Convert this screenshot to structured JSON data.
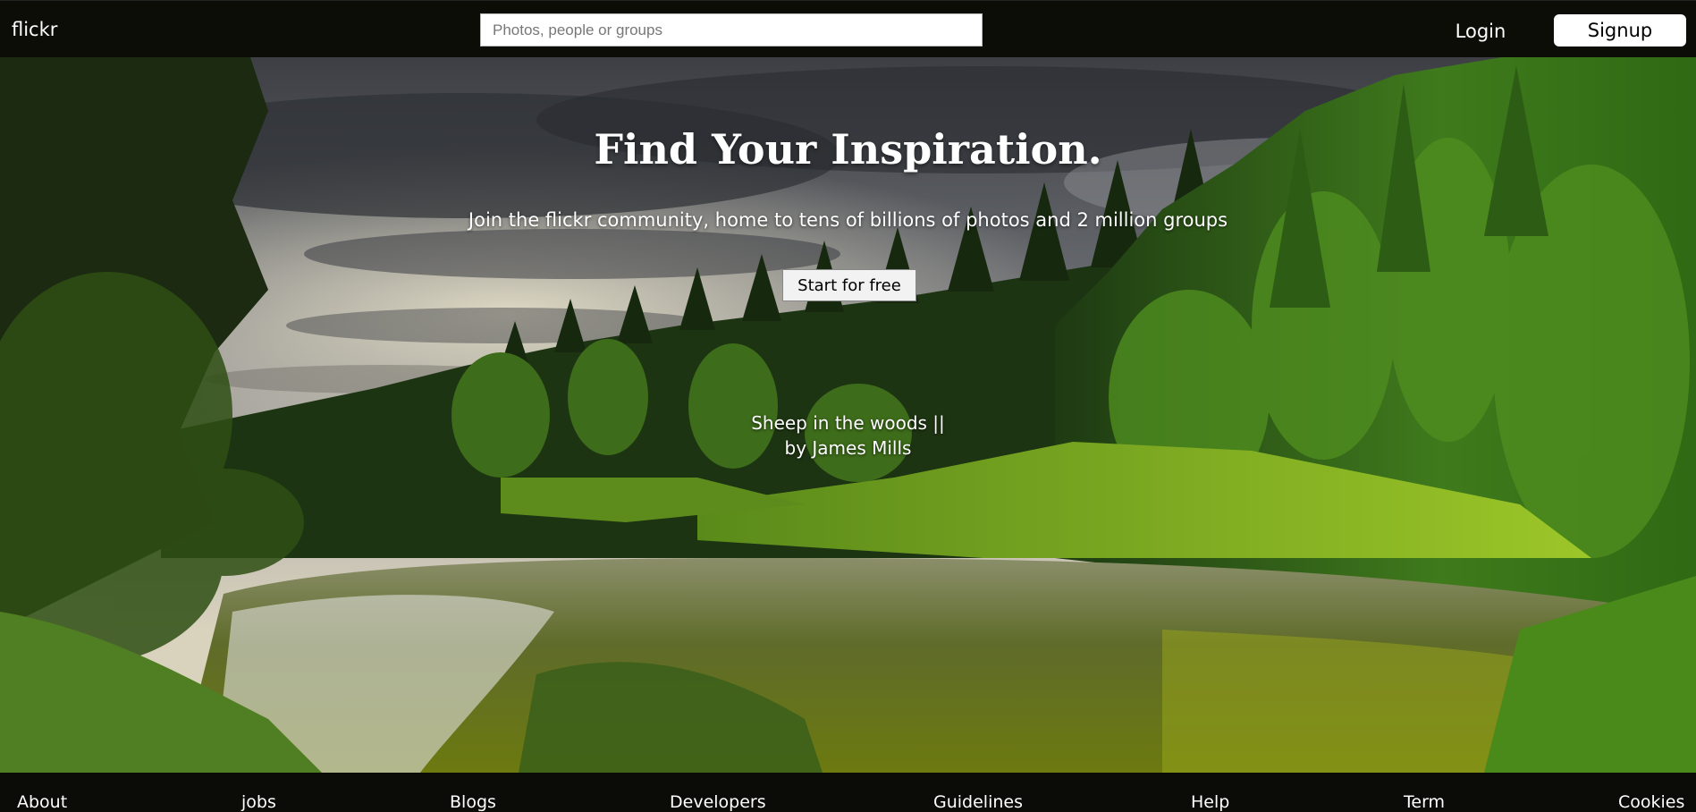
{
  "header": {
    "brand": "flickr",
    "search_placeholder": "Photos, people or groups",
    "login_label": "Login",
    "signup_label": "Signup"
  },
  "hero": {
    "headline": "Find Your Inspiration.",
    "subline": "Join the flickr community, home to tens of billions of photos and 2 million groups",
    "cta_label": "Start for free",
    "photo_title": "Sheep in the woods ||",
    "photo_author": "by James Mills"
  },
  "footer": {
    "links": [
      "About",
      "jobs",
      "Blogs",
      "Developers",
      "Guidelines",
      "Help",
      "Term",
      "Cookies"
    ]
  },
  "colors": {
    "bar_background": "#0d0d08",
    "signup_background": "#ffffff"
  }
}
